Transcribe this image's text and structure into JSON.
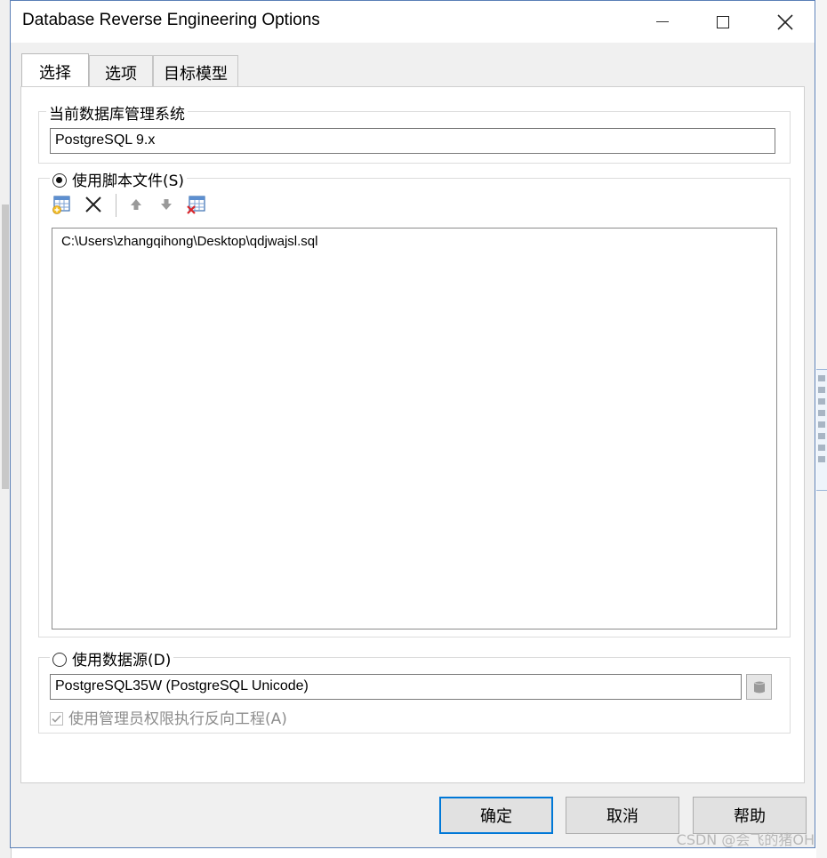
{
  "window": {
    "title": "Database Reverse Engineering Options",
    "controls": {
      "minimize": "—",
      "maximize": "☐",
      "close": "✕"
    }
  },
  "tabs": [
    {
      "label": "选择",
      "active": true
    },
    {
      "label": "选项",
      "active": false
    },
    {
      "label": "目标模型",
      "active": false
    }
  ],
  "dbms_group": {
    "legend": "当前数据库管理系统",
    "value": "PostgreSQL 9.x"
  },
  "script_group": {
    "radio_label": "使用脚本文件(S)",
    "selected": true,
    "toolbar_icons": [
      "add-file-icon",
      "delete-icon",
      "move-up-icon",
      "move-down-icon",
      "clear-list-icon"
    ],
    "files": [
      "C:\\Users\\zhangqihong\\Desktop\\qdjwajsl.sql"
    ]
  },
  "datasource_group": {
    "radio_label": "使用数据源(D)",
    "selected": false,
    "value": "PostgreSQL35W (PostgreSQL Unicode)",
    "admin_checkbox_label": "使用管理员权限执行反向工程(A)",
    "admin_checked": true,
    "admin_disabled": true
  },
  "buttons": {
    "ok": "确定",
    "cancel": "取消",
    "help": "帮助"
  },
  "watermark": "CSDN @会飞的猪OH",
  "colors": {
    "accent": "#0078d7",
    "window_bg": "#f0f0f0",
    "delete_red": "#d9262b"
  }
}
